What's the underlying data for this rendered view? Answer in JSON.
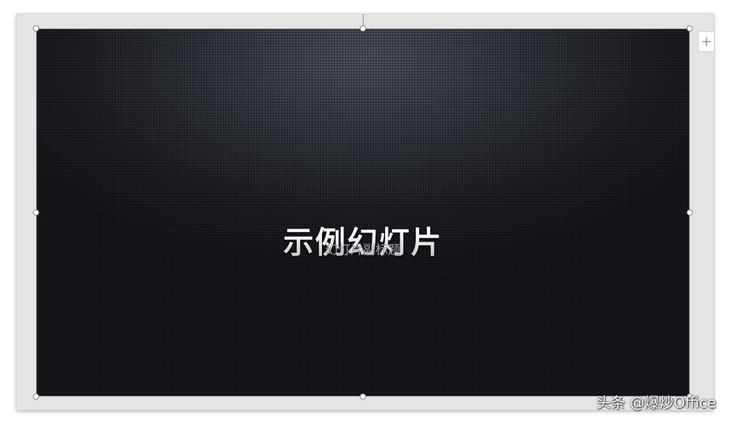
{
  "slide": {
    "title": "示例幻灯片",
    "subtitle": "幻灯片副标题"
  },
  "toolbar": {
    "add_icon": "plus-icon"
  },
  "watermark": {
    "text": "头条 @爆炒Office"
  },
  "colors": {
    "slide_background": "#1d1f24",
    "title_text": "#f2f2f2",
    "subtitle_text": "#9c9ea3",
    "canvas_frame": "#e4e4e4"
  }
}
